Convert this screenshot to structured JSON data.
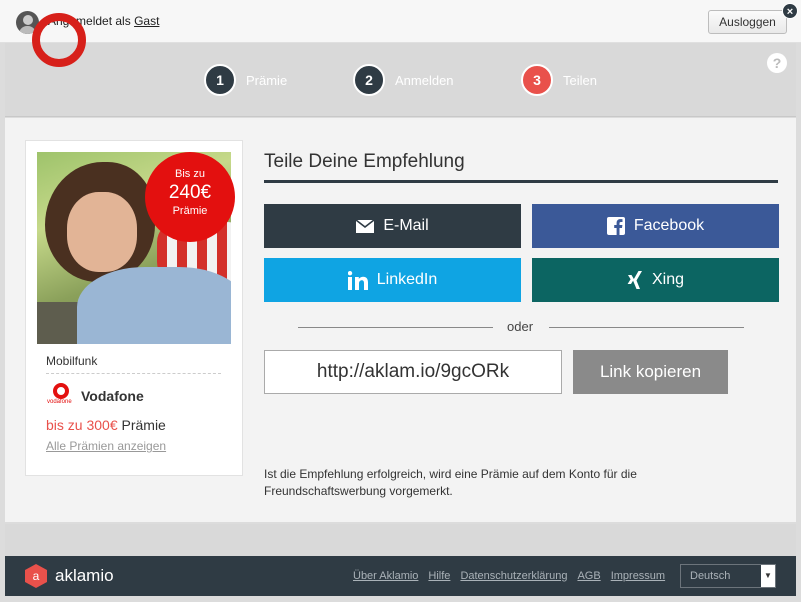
{
  "topbar": {
    "logged_in_prefix": "Angemeldet als",
    "user": "Gast",
    "logout_label": "Ausloggen",
    "close_label": "×"
  },
  "steps": [
    {
      "num": "1",
      "label": "Prämie"
    },
    {
      "num": "2",
      "label": "Anmelden"
    },
    {
      "num": "3",
      "label": "Teilen"
    }
  ],
  "help_label": "?",
  "card": {
    "badge_line1": "Bis zu",
    "badge_amount": "240€",
    "badge_line3": "Prämie",
    "category": "Mobilfunk",
    "provider": "Vodafone",
    "logo_text": "vodafone",
    "reward_amount": "bis zu 300€",
    "reward_suffix": "Prämie",
    "all_rewards_link": "Alle Prämien anzeigen"
  },
  "share": {
    "title": "Teile Deine Empfehlung",
    "buttons": {
      "email": "E-Mail",
      "facebook": "Facebook",
      "linkedin": "LinkedIn",
      "xing": "Xing"
    },
    "or_label": "oder",
    "link_value": "http://aklam.io/9gcORk",
    "copy_label": "Link kopieren",
    "note": "Ist die Empfehlung erfolgreich, wird eine Prämie auf dem Konto für die Freundschaftswerbung vorgemerkt."
  },
  "footer": {
    "brand": "aklamio",
    "logo_letter": "a",
    "links": [
      "Über Aklamio",
      "Hilfe",
      "Datenschutzerklärung",
      "AGB",
      "Impressum"
    ],
    "language": "Deutsch"
  },
  "colors": {
    "dark": "#2f3b44",
    "accent": "#e9514b",
    "facebook": "#3b5998",
    "linkedin": "#0fa4e3",
    "xing": "#0c6562",
    "vodafone_red": "#e3100f"
  }
}
